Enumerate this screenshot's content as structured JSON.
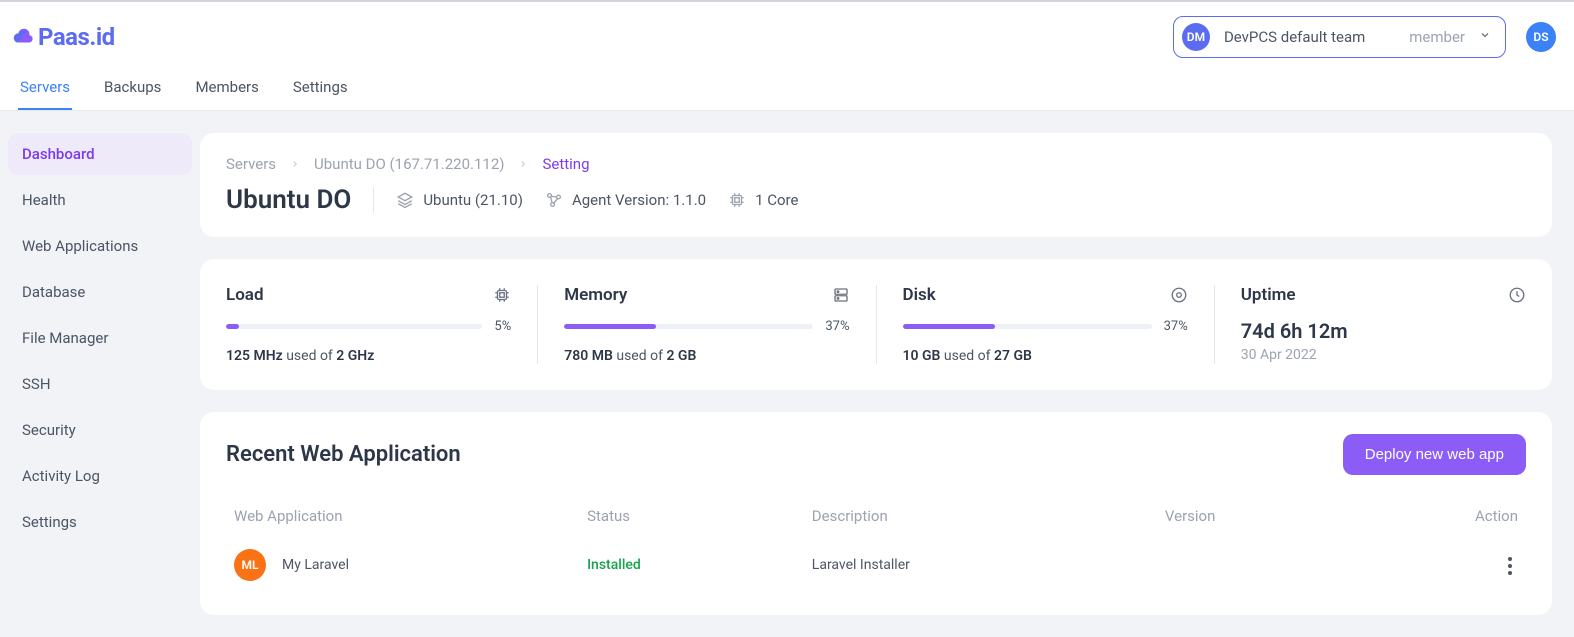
{
  "brand": {
    "name": "Paas.id"
  },
  "header": {
    "team_badge": "DM",
    "team_name": "DevPCS default team",
    "team_role": "member",
    "avatar": "DS"
  },
  "tabs": [
    {
      "label": "Servers",
      "active": true
    },
    {
      "label": "Backups",
      "active": false
    },
    {
      "label": "Members",
      "active": false
    },
    {
      "label": "Settings",
      "active": false
    }
  ],
  "sidebar": [
    {
      "label": "Dashboard",
      "active": true
    },
    {
      "label": "Health"
    },
    {
      "label": "Web Applications"
    },
    {
      "label": "Database"
    },
    {
      "label": "File Manager"
    },
    {
      "label": "SSH"
    },
    {
      "label": "Security"
    },
    {
      "label": "Activity Log"
    },
    {
      "label": "Settings"
    }
  ],
  "breadcrumb": {
    "root": "Servers",
    "server": "Ubuntu DO (167.71.220.112)",
    "current": "Setting"
  },
  "server": {
    "title": "Ubuntu DO",
    "os": "Ubuntu (21.10)",
    "agent_label": "Agent Version: 1.1.0",
    "cores": "1 Core"
  },
  "stats": {
    "load": {
      "title": "Load",
      "percent": 5,
      "percent_text": "5%",
      "used": "125 MHz",
      "used_of": "used of",
      "total": "2 GHz"
    },
    "memory": {
      "title": "Memory",
      "percent": 37,
      "percent_text": "37%",
      "used": "780 MB",
      "used_of": "used of",
      "total": "2 GB"
    },
    "disk": {
      "title": "Disk",
      "percent": 37,
      "percent_text": "37%",
      "used": "10 GB",
      "used_of": "used of",
      "total": "27 GB"
    },
    "uptime": {
      "title": "Uptime",
      "value": "74d 6h 12m",
      "date": "30 Apr 2022"
    }
  },
  "recent": {
    "title": "Recent Web Application",
    "deploy_label": "Deploy new web app",
    "columns": {
      "app": "Web Application",
      "status": "Status",
      "desc": "Description",
      "version": "Version",
      "action": "Action"
    },
    "rows": [
      {
        "badge": "ML",
        "name": "My Laravel",
        "status": "Installed",
        "desc": "Laravel Installer",
        "version": ""
      }
    ]
  }
}
